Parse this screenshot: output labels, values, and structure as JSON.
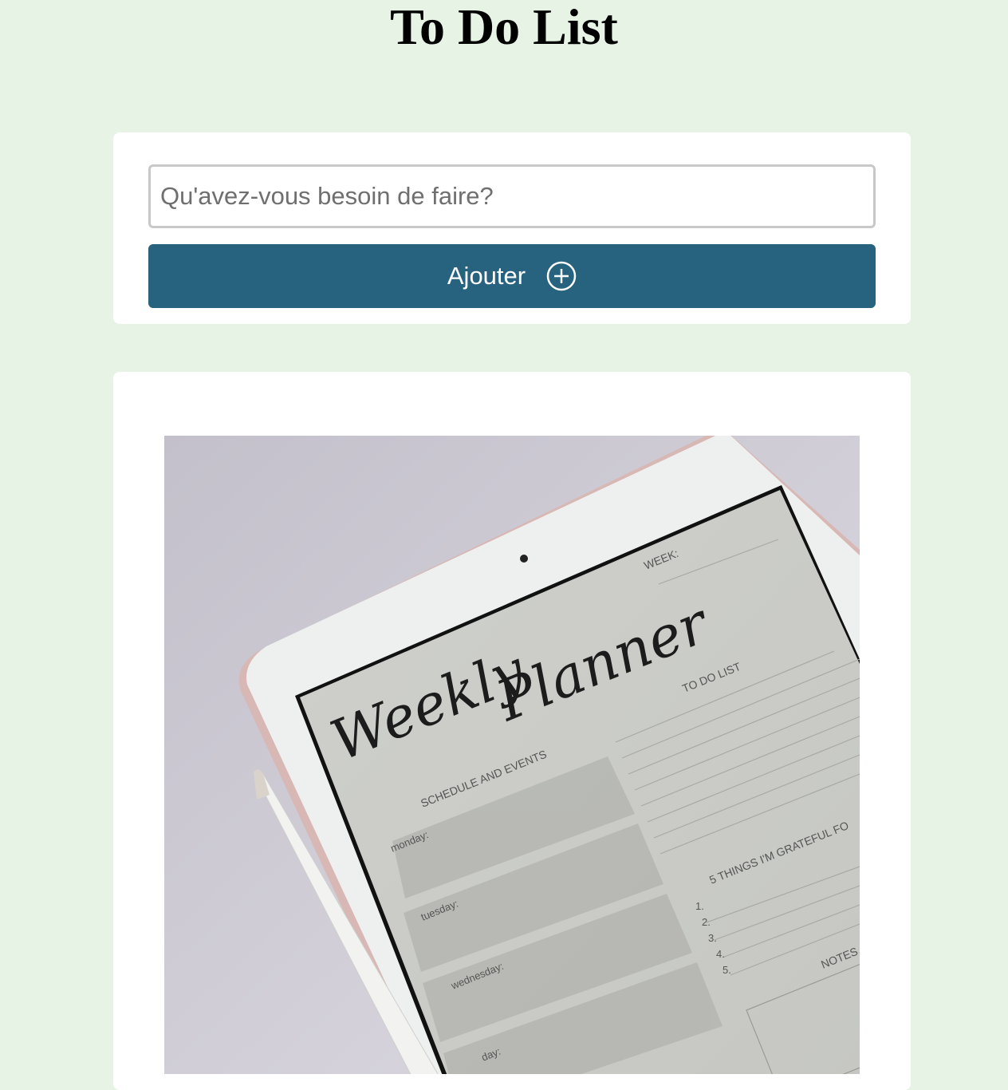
{
  "page": {
    "title": "To Do List"
  },
  "form": {
    "input_placeholder": "Qu'avez-vous besoin de faire?",
    "input_value": "",
    "add_label": "Ajouter",
    "add_icon": "plus-circle-icon"
  },
  "image": {
    "week": "WEEK:",
    "script_title_1": "Weekly",
    "script_title_2": "Planner",
    "todo": "TO DO LIST",
    "schedule": "SCHEDULE AND EVENTS",
    "days": [
      "monday:",
      "tuesday:",
      "wednesday:",
      "day:"
    ],
    "grateful": "5 THINGS I'M GRATEFUL FO",
    "numbers": [
      "1.",
      "2.",
      "3.",
      "4.",
      "5."
    ],
    "notes": "NOTES"
  },
  "colors": {
    "background": "#e6f3e5",
    "card": "#ffffff",
    "button": "#27627e",
    "input_border": "#c8c8c8"
  }
}
